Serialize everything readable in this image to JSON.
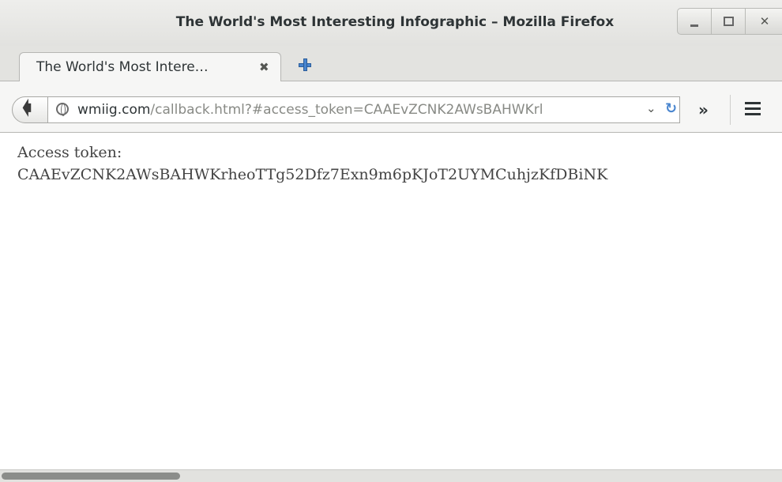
{
  "window": {
    "title": "The World's Most Interesting Infographic – Mozilla Firefox",
    "controls": {
      "minimize": "minimize",
      "maximize": "maximize",
      "close": "✕"
    }
  },
  "tabs": [
    {
      "title": "The World's Most Intere…",
      "close": "✖"
    }
  ],
  "toolbar": {
    "url_host": "wmiig.com",
    "url_rest": "/callback.html?#access_token=CAAEvZCNK2AWsBAHWKrl",
    "overflow": "»"
  },
  "content": {
    "label": "Access token:",
    "token": "CAAEvZCNK2AWsBAHWKrheoTTg52Dfz7Exn9m6pKJoT2UYMCuhjzKfDBiNK"
  },
  "icons": {
    "back": "back-arrow-icon",
    "site": "globe-icon",
    "dropdown": "chevron-down-icon",
    "reload": "reload-icon",
    "newtab": "plus-icon",
    "menu": "hamburger-menu-icon"
  },
  "colors": {
    "accent": "#4a86cf",
    "chrome": "#e3e3e0",
    "text": "#2e3436"
  }
}
